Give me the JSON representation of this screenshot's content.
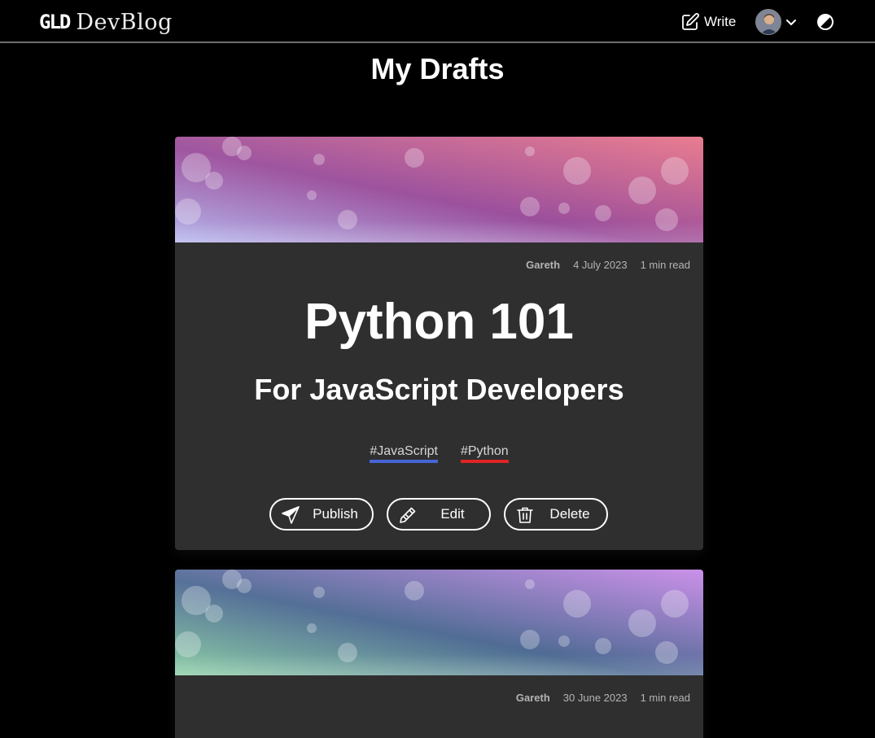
{
  "navbar": {
    "logo_mark": "GLD",
    "logo_text": "DevBlog",
    "write_label": "Write"
  },
  "page": {
    "title": "My Drafts"
  },
  "drafts": [
    {
      "author": "Gareth",
      "date": "4 July 2023",
      "read_time": "1 min read",
      "title": "Python 101",
      "subtitle": "For JavaScript Developers",
      "tags": [
        {
          "label": "#JavaScript",
          "color": "#4666d6"
        },
        {
          "label": "#Python",
          "color": "#e02424"
        }
      ],
      "actions": {
        "publish": "Publish",
        "edit": "Edit",
        "delete": "Delete"
      },
      "cover_colors": [
        "#b6b8ee",
        "#9b4f9c",
        "#e8768a"
      ]
    },
    {
      "author": "Gareth",
      "date": "30 June 2023",
      "read_time": "1 min read",
      "cover_colors": [
        "#8fd0a8",
        "#4f6b94",
        "#c88be8"
      ]
    }
  ],
  "colors": {
    "background": "#000000",
    "card": "#2f2f2f",
    "nav_border": "#6e6e6e"
  },
  "icons": [
    "edit-square-icon",
    "avatar",
    "chevron-down-icon",
    "contrast-icon",
    "paper-plane-icon",
    "pencil-icon",
    "trash-icon"
  ]
}
